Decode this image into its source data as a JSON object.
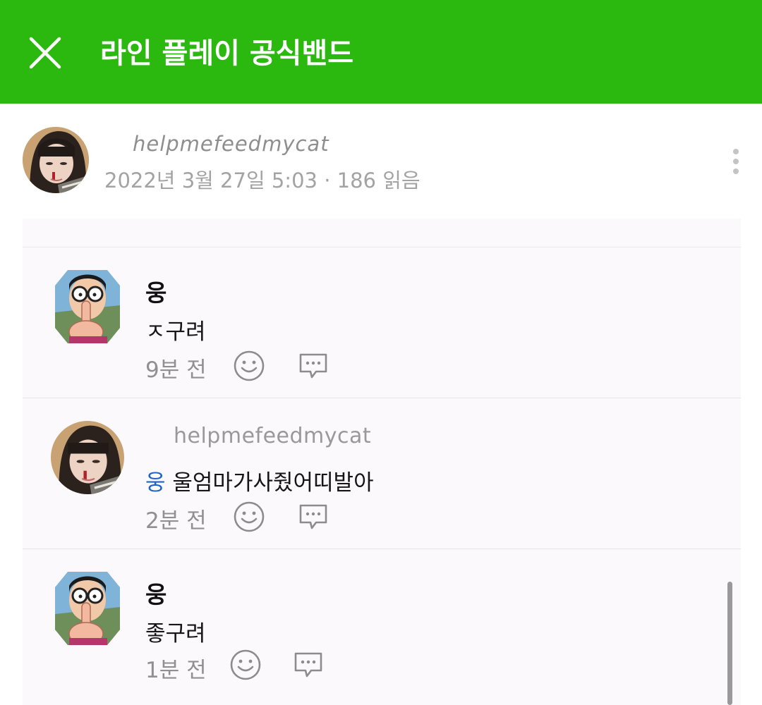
{
  "header": {
    "title": "라인 플레이 공식밴드",
    "close_icon": "close-icon",
    "background_color": "#2bb80f"
  },
  "post": {
    "author": "helpmefeedmycat",
    "meta": "2022년 3월 27일 5:03 · 186 읽음",
    "more_icon": "more-vertical-icon"
  },
  "comments": [
    {
      "author": "웅",
      "text": "ㅈ구려",
      "time": "9분 전"
    },
    {
      "author": "helpmefeedmycat",
      "mention": "웅",
      "text": "울엄마가사줬어띠발아",
      "time": "2분 전"
    },
    {
      "author": "웅",
      "text": "좋구려",
      "time": "1분 전"
    }
  ],
  "colors": {
    "accent_green": "#2bb80f",
    "mention_blue": "#1e64c8"
  }
}
